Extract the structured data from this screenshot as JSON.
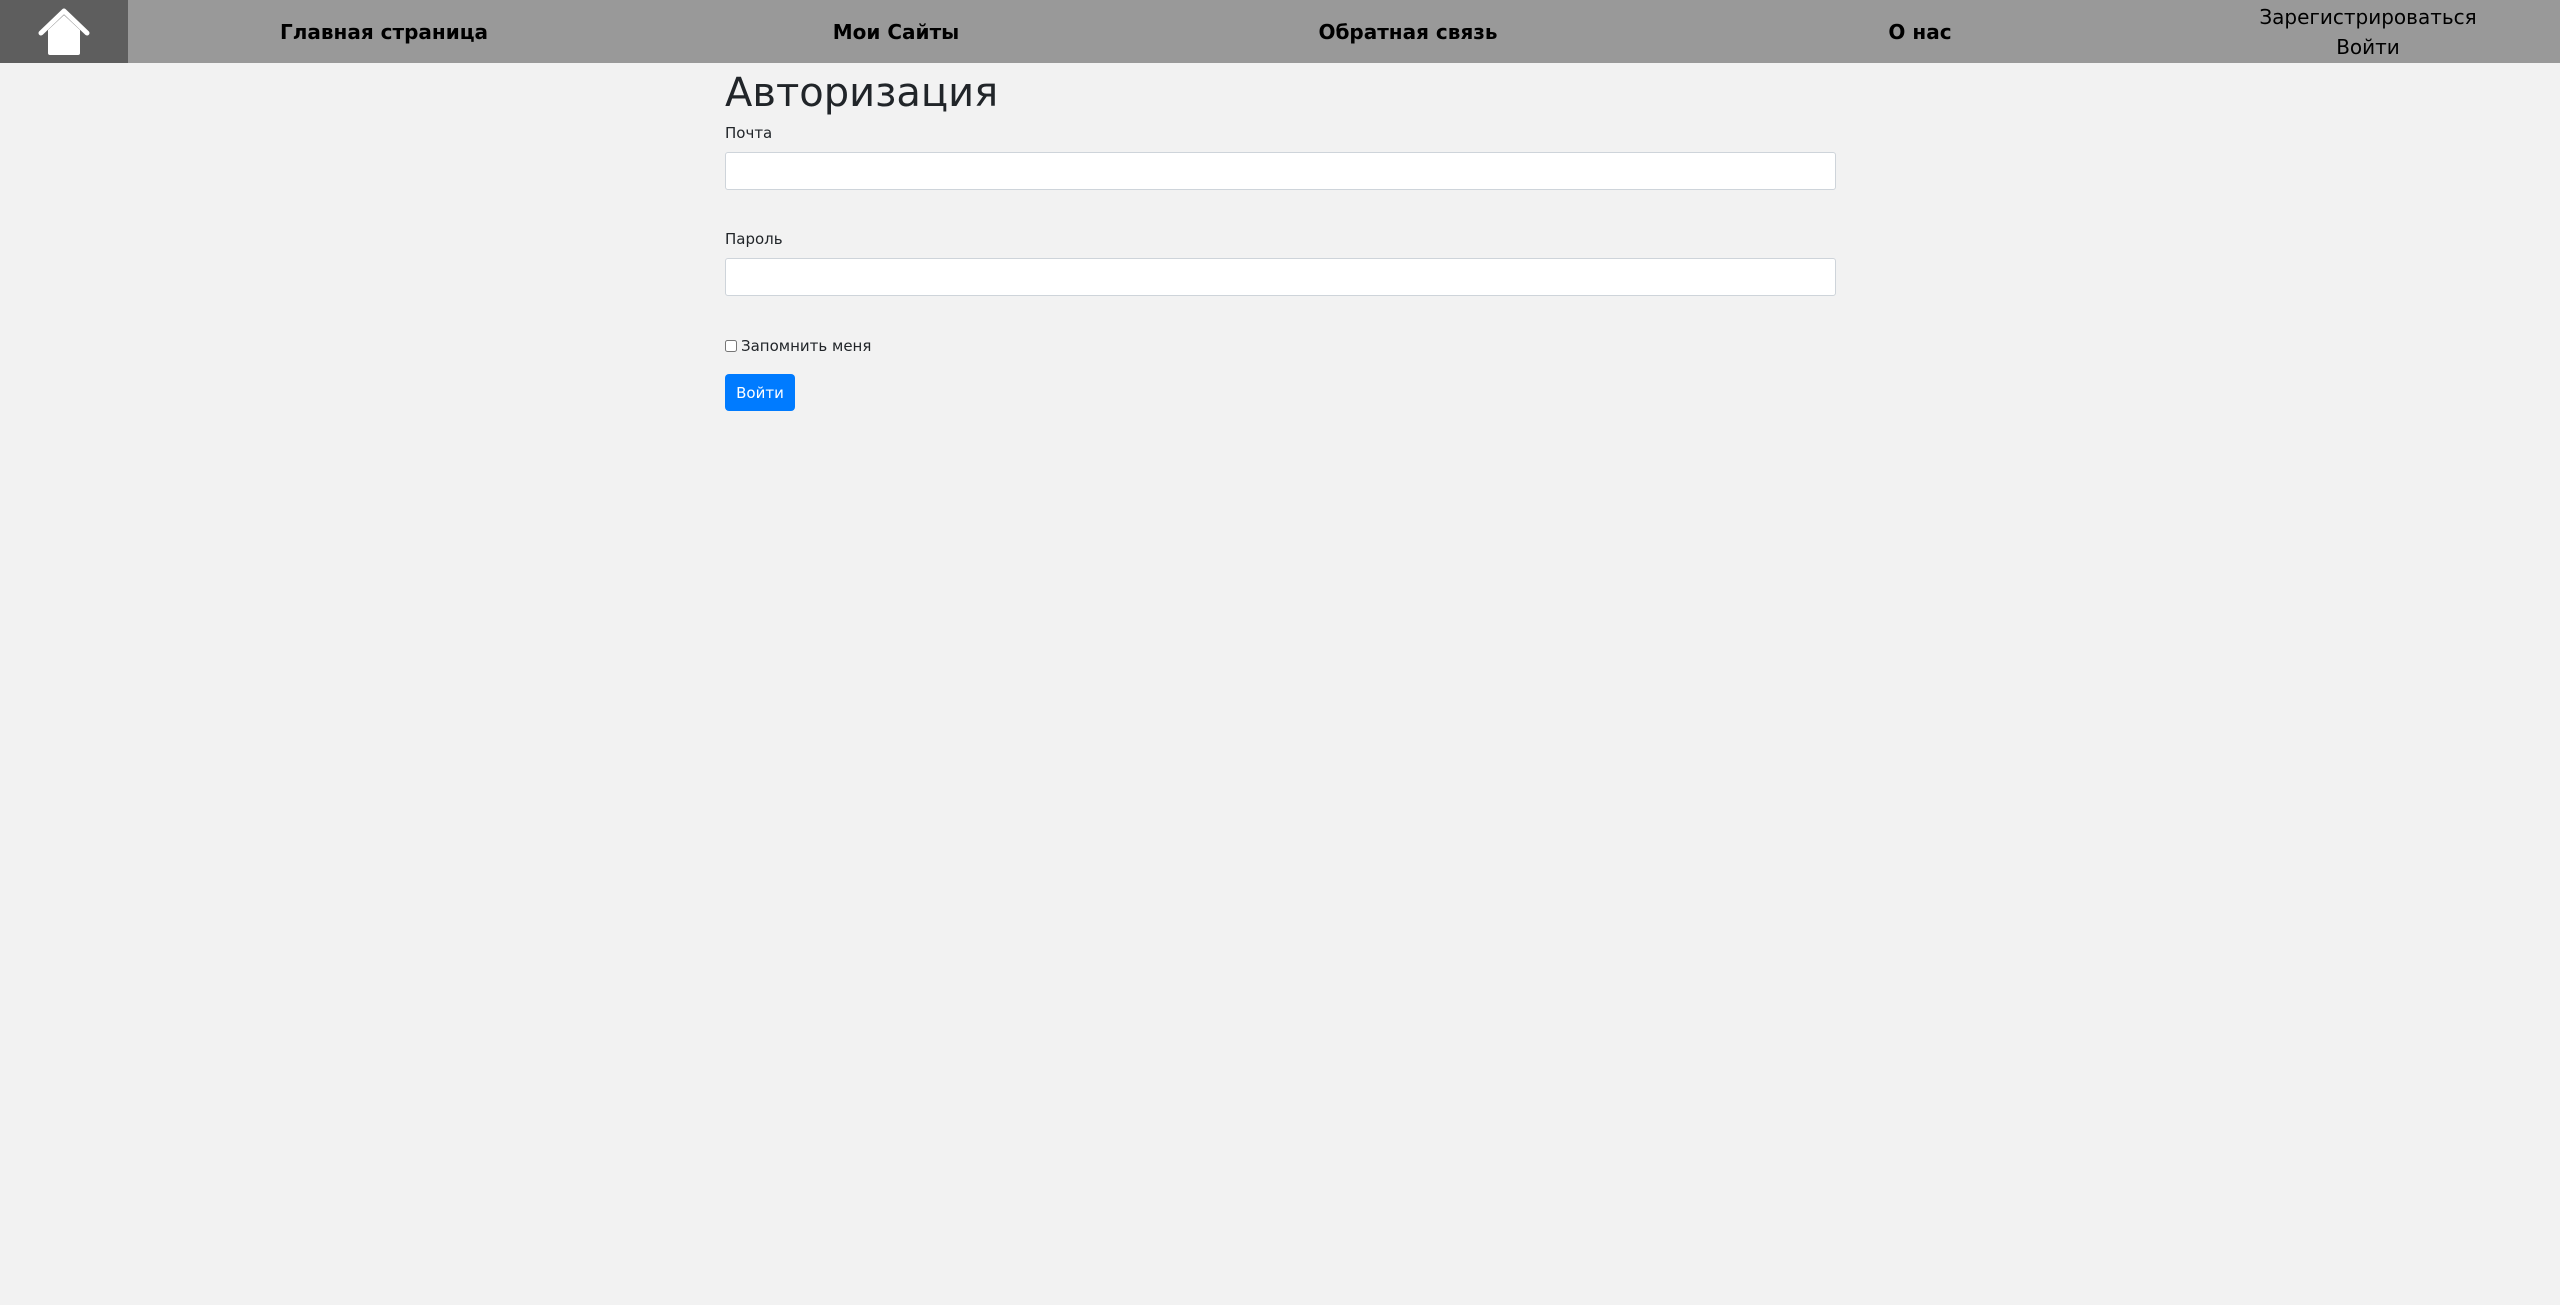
{
  "nav": {
    "home_icon": "house-icon",
    "links": [
      "Главная страница",
      "Мои Сайты",
      "Обратная связь",
      "О нас"
    ],
    "register": "Зарегистрироваться",
    "login": "Войти"
  },
  "form": {
    "title": "Авторизация",
    "email_label": "Почта",
    "email_value": "",
    "password_label": "Пароль",
    "password_value": "",
    "remember_label": "Запомнить меня",
    "remember_checked": false,
    "submit_label": "Войти"
  },
  "colors": {
    "navbar": "#999999",
    "home_bg": "#5e5e5e",
    "page_bg": "#f2f2f2",
    "primary": "#007bff"
  }
}
